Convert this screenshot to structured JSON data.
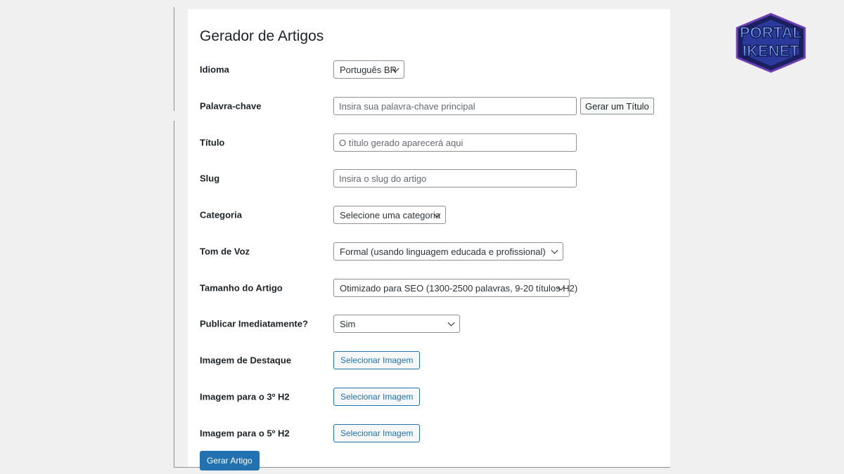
{
  "page": {
    "title": "Gerador de Artigos"
  },
  "form": {
    "idioma": {
      "label": "Idioma",
      "value": "Português BR"
    },
    "palavra_chave": {
      "label": "Palavra-chave",
      "placeholder": "Insira sua palavra-chave principal",
      "button_label": "Gerar um Título"
    },
    "titulo": {
      "label": "Título",
      "placeholder": "O título gerado aparecerá aqui"
    },
    "slug": {
      "label": "Slug",
      "placeholder": "Insira o slug do artigo"
    },
    "categoria": {
      "label": "Categoria",
      "value": "Selecione uma categoria"
    },
    "tom_de_voz": {
      "label": "Tom de Voz",
      "value": "Formal (usando linguagem educada e profissional)"
    },
    "tamanho": {
      "label": "Tamanho do Artigo",
      "value": "Otimizado para SEO (1300-2500 palavras, 9-20 títulos H2)"
    },
    "publicar": {
      "label": "Publicar Imediatamente?",
      "value": "Sim"
    },
    "imagem_destaque": {
      "label": "Imagem de Destaque",
      "button_label": "Selecionar Imagem"
    },
    "imagem_h2_3": {
      "label": "Imagem para o 3º H2",
      "button_label": "Selecionar Imagem"
    },
    "imagem_h2_5": {
      "label": "Imagem para o 5º H2",
      "button_label": "Selecionar Imagem"
    },
    "submit_label": "Gerar Artigo"
  },
  "logo": {
    "line1": "PORTAL",
    "line2": "IKENET"
  },
  "colors": {
    "accent": "#2271b1",
    "background": "#f0f0f1",
    "panel": "#ffffff",
    "logo_blue": "#3a6fd8",
    "logo_purple": "#6a3fb5"
  }
}
